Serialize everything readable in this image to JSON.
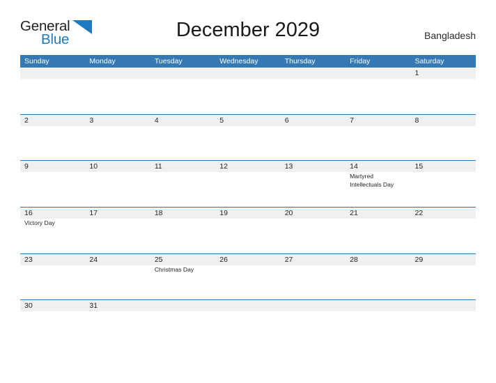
{
  "brand": {
    "name_part1": "General",
    "name_part2": "Blue",
    "flag_icon": "triangle-flag-icon",
    "color_dark": "#231f20",
    "color_blue": "#1e78c2"
  },
  "header": {
    "title": "December 2029",
    "country": "Bangladesh"
  },
  "colors": {
    "header_blue": "#3478b4",
    "row_rule_blue": "#2e75b6",
    "date_band_gray": "#f0f0f0",
    "page_background": "#ffffff",
    "text": "#1a1a1a"
  },
  "calendar": {
    "month": "December",
    "year": "2029",
    "weekday_headers": [
      "Sunday",
      "Monday",
      "Tuesday",
      "Wednesday",
      "Thursday",
      "Friday",
      "Saturday"
    ],
    "weeks": [
      [
        {
          "date": "",
          "events": []
        },
        {
          "date": "",
          "events": []
        },
        {
          "date": "",
          "events": []
        },
        {
          "date": "",
          "events": []
        },
        {
          "date": "",
          "events": []
        },
        {
          "date": "",
          "events": []
        },
        {
          "date": "1",
          "events": []
        }
      ],
      [
        {
          "date": "2",
          "events": []
        },
        {
          "date": "3",
          "events": []
        },
        {
          "date": "4",
          "events": []
        },
        {
          "date": "5",
          "events": []
        },
        {
          "date": "6",
          "events": []
        },
        {
          "date": "7",
          "events": []
        },
        {
          "date": "8",
          "events": []
        }
      ],
      [
        {
          "date": "9",
          "events": []
        },
        {
          "date": "10",
          "events": []
        },
        {
          "date": "11",
          "events": []
        },
        {
          "date": "12",
          "events": []
        },
        {
          "date": "13",
          "events": []
        },
        {
          "date": "14",
          "events": [
            "Martyred Intellectuals Day"
          ]
        },
        {
          "date": "15",
          "events": []
        }
      ],
      [
        {
          "date": "16",
          "events": [
            "Victory Day"
          ]
        },
        {
          "date": "17",
          "events": []
        },
        {
          "date": "18",
          "events": []
        },
        {
          "date": "19",
          "events": []
        },
        {
          "date": "20",
          "events": []
        },
        {
          "date": "21",
          "events": []
        },
        {
          "date": "22",
          "events": []
        }
      ],
      [
        {
          "date": "23",
          "events": []
        },
        {
          "date": "24",
          "events": []
        },
        {
          "date": "25",
          "events": [
            "Christmas Day"
          ]
        },
        {
          "date": "26",
          "events": []
        },
        {
          "date": "27",
          "events": []
        },
        {
          "date": "28",
          "events": []
        },
        {
          "date": "29",
          "events": []
        }
      ],
      [
        {
          "date": "30",
          "events": []
        },
        {
          "date": "31",
          "events": []
        },
        {
          "date": "",
          "events": []
        },
        {
          "date": "",
          "events": []
        },
        {
          "date": "",
          "events": []
        },
        {
          "date": "",
          "events": []
        },
        {
          "date": "",
          "events": []
        }
      ]
    ]
  }
}
